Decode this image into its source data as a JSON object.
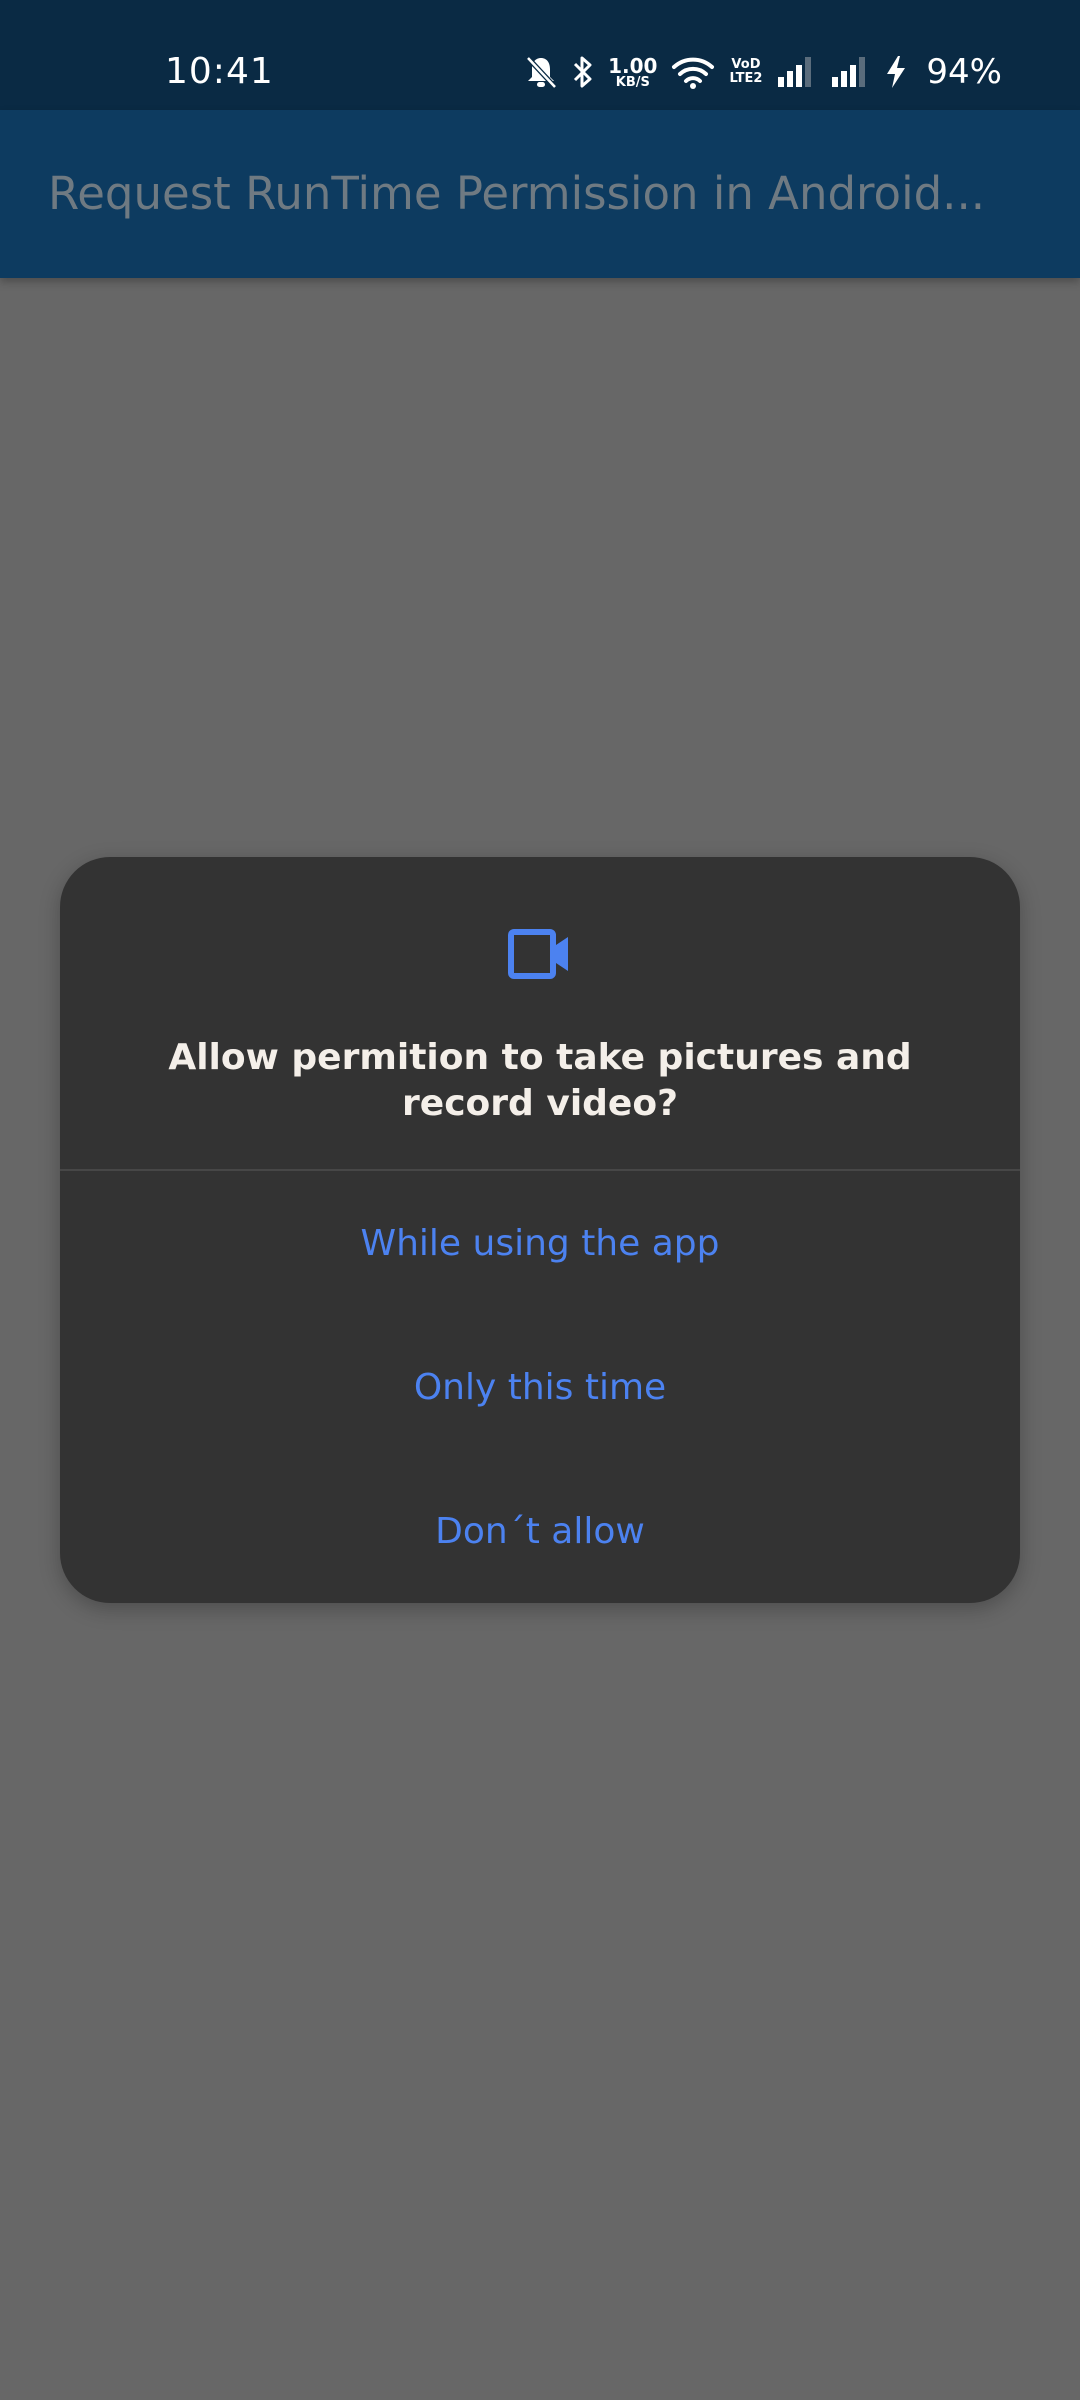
{
  "status_bar": {
    "time": "10:41",
    "speed_value": "1.00",
    "speed_unit": "KB/S",
    "volte_top": "VoD",
    "volte_bottom": "LTE2",
    "battery_percent": "94%",
    "icons": [
      "bell-muted-icon",
      "bluetooth-icon",
      "wifi-icon",
      "signal-icon",
      "signal-icon",
      "charging-icon"
    ]
  },
  "app_bar": {
    "title": "Request RunTime Permission in Android..."
  },
  "dialog": {
    "icon": "video-camera-icon",
    "title": "Allow permition to take pictures and record video?",
    "buttons": {
      "while_using": "While using the app",
      "only_this_time": "Only this time",
      "dont_allow": "Don´t allow"
    }
  },
  "colors": {
    "status_bar_bg": "#0a2a44",
    "app_bar_bg": "#0d3b60",
    "scrim": "#676767",
    "dialog_bg": "#333333",
    "accent": "#4c82f0",
    "dialog_title": "#f4efe9"
  }
}
